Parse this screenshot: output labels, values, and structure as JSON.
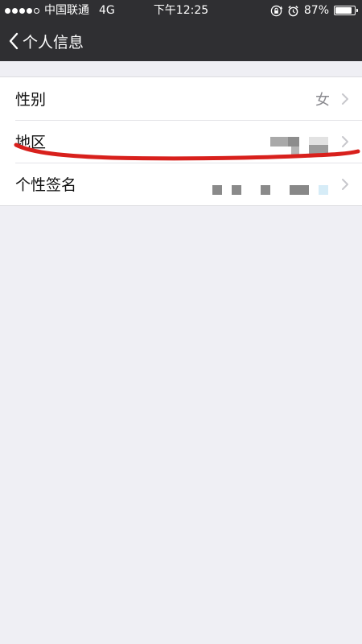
{
  "status_bar": {
    "carrier": "中国联通",
    "network": "4G",
    "time": "下午12:25",
    "battery": "87%",
    "battery_level": 0.87
  },
  "nav": {
    "title": "个人信息"
  },
  "rows": [
    {
      "label": "性别",
      "value": "女"
    },
    {
      "label": "地区",
      "value": ""
    },
    {
      "label": "个性签名",
      "value": ""
    }
  ],
  "colors": {
    "bar_background": "#2f2f32",
    "page_background": "#efeff4",
    "annotation_stroke": "#d8201c"
  }
}
